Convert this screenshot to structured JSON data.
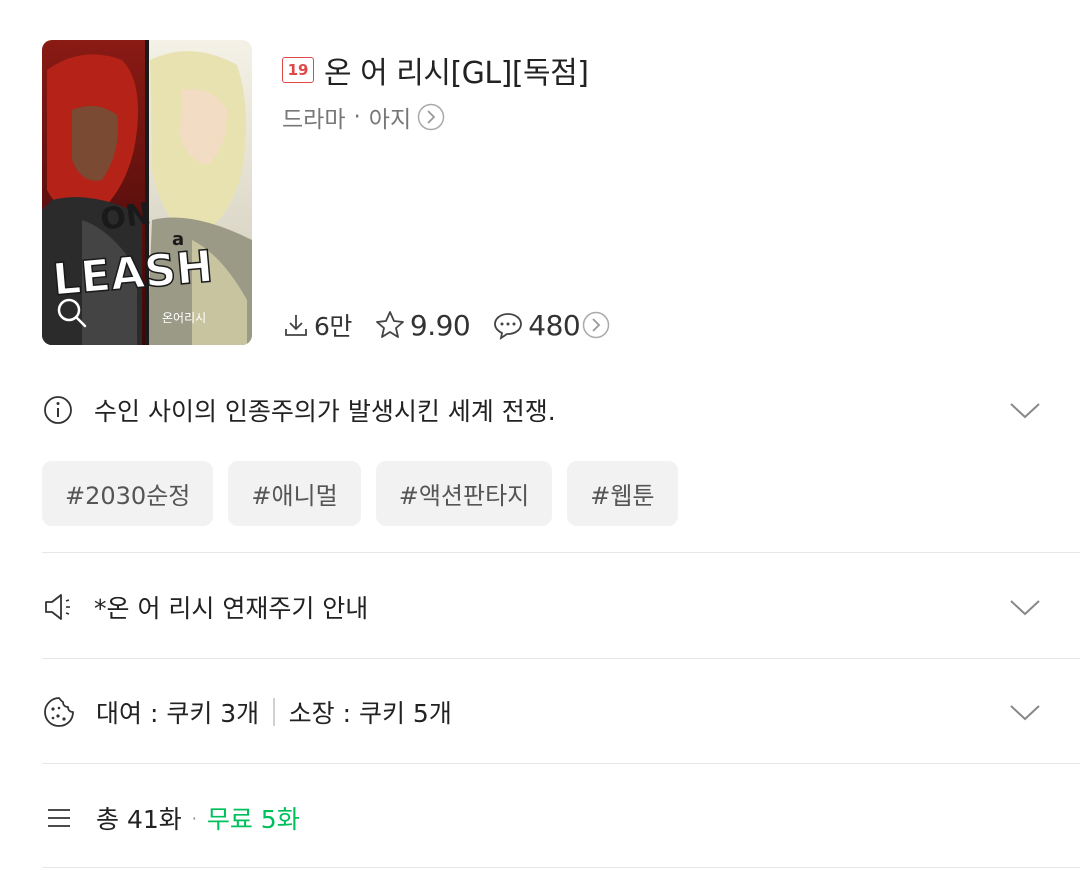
{
  "header": {
    "age_badge": "19",
    "title": "온 어 리시[GL][독점]",
    "genre": "드라마",
    "author": "아지",
    "cover_text": "ON A LEASH",
    "cover_subtitle": "온어리시"
  },
  "stats": {
    "downloads": "6만",
    "rating": "9.90",
    "comments": "480"
  },
  "description": "수인 사이의 인종주의가 발생시킨 세계 전쟁.",
  "tags": [
    "#2030순정",
    "#애니멀",
    "#액션판타지",
    "#웹툰"
  ],
  "notice": "*온 어 리시 연재주기 안내",
  "price": {
    "rent": "대여 : 쿠키 3개",
    "own": "소장 : 쿠키 5개"
  },
  "episodes": {
    "total": "총 41화",
    "free": "무료 5화"
  },
  "colors": {
    "accent_green": "#00c05c",
    "badge_red": "#e04848",
    "tag_bg": "#f2f2f2"
  },
  "icons": [
    "search-icon",
    "download-icon",
    "star-icon",
    "comment-icon",
    "info-icon",
    "speaker-icon",
    "cookie-icon",
    "list-icon",
    "chevron-down-icon",
    "chevron-right-circle-icon"
  ]
}
